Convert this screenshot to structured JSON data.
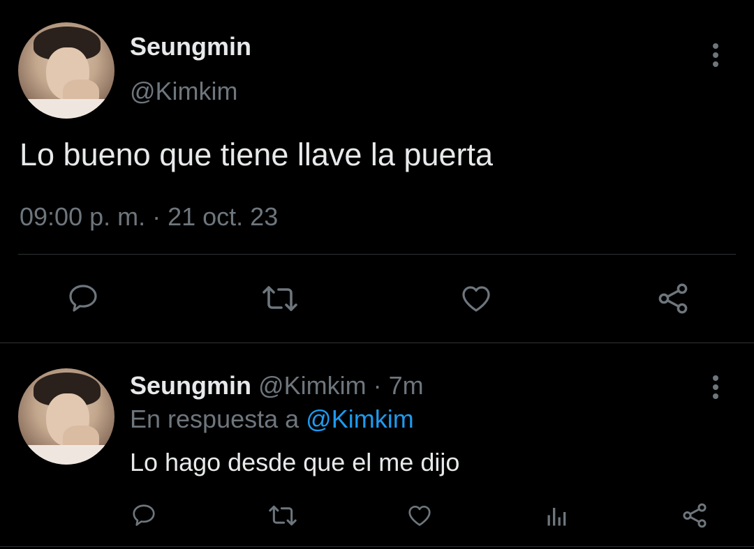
{
  "main_tweet": {
    "display_name": "Seungmin",
    "handle": "@Kimkim",
    "text": "Lo bueno que tiene llave la puerta",
    "timestamp": "09:00 p. m. · 21 oct. 23",
    "actions": [
      "reply-icon",
      "retweet-icon",
      "like-icon",
      "share-icon"
    ]
  },
  "reply_tweet": {
    "display_name": "Seungmin",
    "handle": "@Kimkim",
    "separator": "·",
    "time_ago": "7m",
    "reply_prefix": "En respuesta a",
    "reply_to": "@Kimkim",
    "text": "Lo hago desde que el me dijo",
    "actions": [
      "reply-icon",
      "retweet-icon",
      "like-icon",
      "analytics-icon",
      "share-icon"
    ]
  },
  "colors": {
    "background": "#000000",
    "text": "#e7e9ea",
    "muted": "#6e767d",
    "link": "#1d9bf0",
    "divider": "#2f3336"
  }
}
